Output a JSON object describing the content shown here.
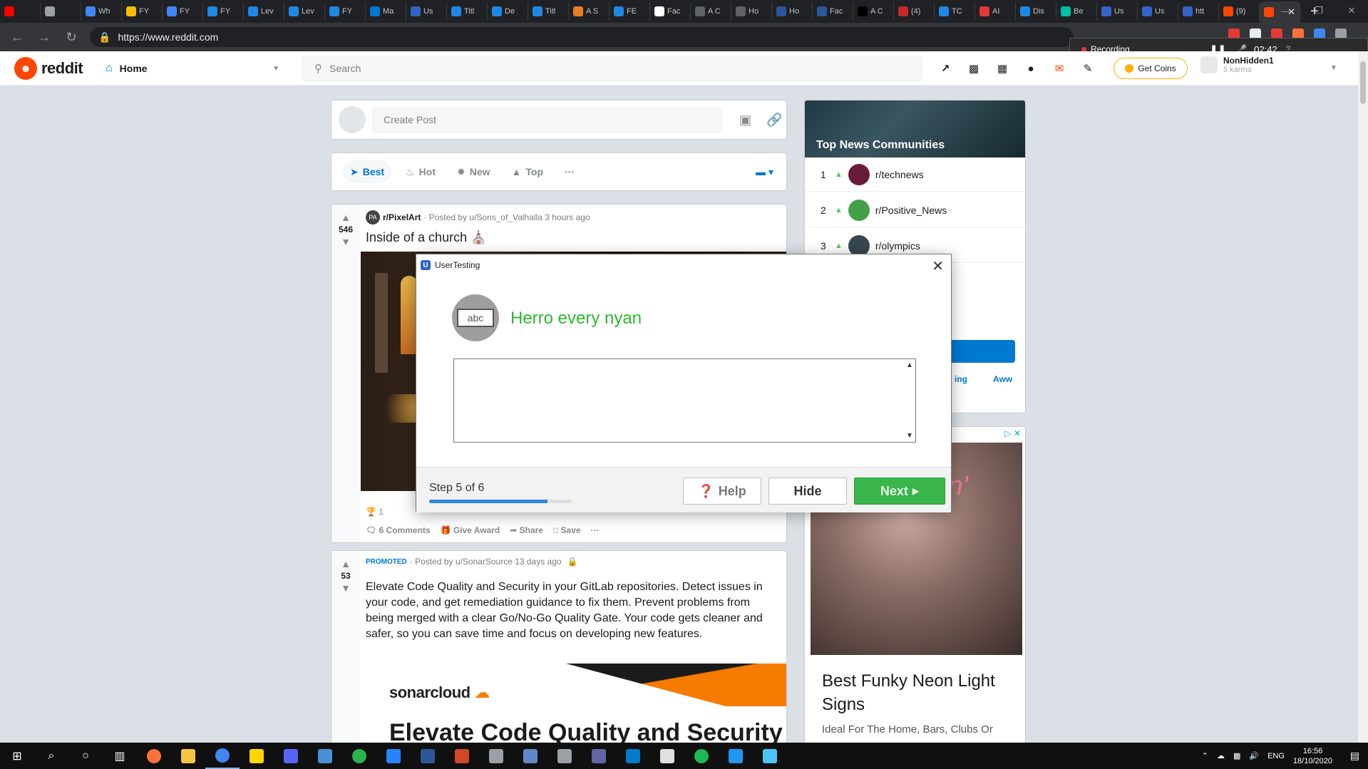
{
  "browser": {
    "tabs": [
      {
        "label": "",
        "color": "#ff0000"
      },
      {
        "label": "",
        "color": "#9aa0a6"
      },
      {
        "label": "Wh",
        "color": "#4285f4"
      },
      {
        "label": "FY",
        "color": "#fbbc04"
      },
      {
        "label": "FY",
        "color": "#4285f4"
      },
      {
        "label": "FY",
        "color": "#1e88e5"
      },
      {
        "label": "Lev",
        "color": "#1e88e5"
      },
      {
        "label": "Lev",
        "color": "#1e88e5"
      },
      {
        "label": "FY",
        "color": "#1e88e5"
      },
      {
        "label": "Ma",
        "color": "#0078d4"
      },
      {
        "label": "Us",
        "color": "#3264c8"
      },
      {
        "label": "Titl",
        "color": "#1e88e5"
      },
      {
        "label": "De",
        "color": "#1e88e5"
      },
      {
        "label": "Titl",
        "color": "#1e88e5"
      },
      {
        "label": "A S",
        "color": "#e67e22"
      },
      {
        "label": "FE",
        "color": "#1e88e5"
      },
      {
        "label": "Fac",
        "color": "#ffffff"
      },
      {
        "label": "A C",
        "color": "#5f6368"
      },
      {
        "label": "Ho",
        "color": "#5f6368"
      },
      {
        "label": "Ho",
        "color": "#2b579a"
      },
      {
        "label": "Fac",
        "color": "#2b579a"
      },
      {
        "label": "A C",
        "color": "#000000"
      },
      {
        "label": "(4)",
        "color": "#c62828"
      },
      {
        "label": "TC",
        "color": "#1e88e5"
      },
      {
        "label": "AI",
        "color": "#e53935"
      },
      {
        "label": "Dis",
        "color": "#1e88e5"
      },
      {
        "label": "Be",
        "color": "#00bfa5"
      },
      {
        "label": "Us",
        "color": "#3264c8"
      },
      {
        "label": "Us",
        "color": "#3264c8"
      },
      {
        "label": "htt",
        "color": "#3264c8"
      },
      {
        "label": "(9)",
        "color": "#ff4500"
      },
      {
        "label": "",
        "color": "#ff4500",
        "active": true
      }
    ],
    "url": "https://www.reddit.com"
  },
  "recording": {
    "label": "Recording",
    "time": "02:42"
  },
  "header": {
    "logo_text": "reddit",
    "home_label": "Home",
    "search_placeholder": "Search",
    "get_coins": "Get Coins",
    "username": "NonHidden1",
    "karma": "5 karma"
  },
  "createpost": {
    "placeholder": "Create Post"
  },
  "sort": {
    "best": "Best",
    "hot": "Hot",
    "new": "New",
    "top": "Top",
    "more": "···"
  },
  "post1": {
    "votes": "546",
    "subreddit": "r/PixelArt",
    "sub_icon": "PA",
    "posted_by": "· Posted by u/Sons_of_Valhalla 3 hours ago",
    "title": "Inside of a church ⛪",
    "award_count": "1",
    "comments": "6 Comments",
    "give_award": "Give Award",
    "share": "Share",
    "save": "Save",
    "more": "···"
  },
  "post2": {
    "votes": "53",
    "promoted": "PROMOTED",
    "posted_by": "· Posted by u/SonarSource 13 days ago",
    "body": "Elevate Code Quality and Security in your GitLab repositories. Detect issues in your code, and get remediation guidance to fix them. Prevent problems from being merged with a clear Go/No-Go Quality Gate. Your code gets cleaner and safer, so you can save time and focus on developing new features.",
    "sonar_logo": "sonarcloud",
    "sonar_headline": "Elevate Code Quality and Security"
  },
  "sidebar": {
    "title": "Top News Communities",
    "communities": [
      {
        "rank": "1",
        "name": "r/technews",
        "color": "#6a1b3a"
      },
      {
        "rank": "2",
        "name": "r/Positive_News",
        "color": "#43a047"
      },
      {
        "rank": "3",
        "name": "r/olympics",
        "color": "#37474f"
      }
    ],
    "chip1": "ing",
    "chip2": "Aww"
  },
  "ad": {
    "neon": "Dreamin'",
    "title": "Best Funky Neon Light Signs",
    "sub": "Ideal For The Home, Bars, Clubs Or"
  },
  "dialog": {
    "app_name": "UserTesting",
    "avatar_text": "abc",
    "heading": "Herro every nyan",
    "response_value": "",
    "step_text": "Step 5 of 6",
    "progress": 0.83,
    "help": "Help",
    "hide": "Hide",
    "next": "Next"
  },
  "taskbar": {
    "apps": [
      {
        "name": "search",
        "color": ""
      },
      {
        "name": "cortana",
        "color": ""
      },
      {
        "name": "task-view",
        "color": ""
      },
      {
        "name": "firefox",
        "color": "#ff7139"
      },
      {
        "name": "explorer",
        "color": "#f4c542"
      },
      {
        "name": "chrome",
        "color": "#4285f4",
        "active": true
      },
      {
        "name": "sticky-notes",
        "color": "#ffd600"
      },
      {
        "name": "discord",
        "color": "#5865f2"
      },
      {
        "name": "virtualbox",
        "color": "#4a90d9"
      },
      {
        "name": "obs",
        "color": "#2bb24c"
      },
      {
        "name": "sourcetree",
        "color": "#2684ff"
      },
      {
        "name": "word",
        "color": "#2b579a"
      },
      {
        "name": "powerpoint",
        "color": "#d24726"
      },
      {
        "name": "photos",
        "color": "#9aa0a6"
      },
      {
        "name": "tool",
        "color": "#5f88c6"
      },
      {
        "name": "settings",
        "color": "#9aa0a6"
      },
      {
        "name": "teams",
        "color": "#6264a7"
      },
      {
        "name": "vscode",
        "color": "#007acc"
      },
      {
        "name": "unity",
        "color": "#e0e0e0"
      },
      {
        "name": "spotify",
        "color": "#1db954"
      },
      {
        "name": "terminal",
        "color": "#2196f3"
      },
      {
        "name": "paint",
        "color": "#4fc3f7"
      }
    ],
    "lang": "ENG",
    "time": "16:56",
    "date": "18/10/2020"
  }
}
